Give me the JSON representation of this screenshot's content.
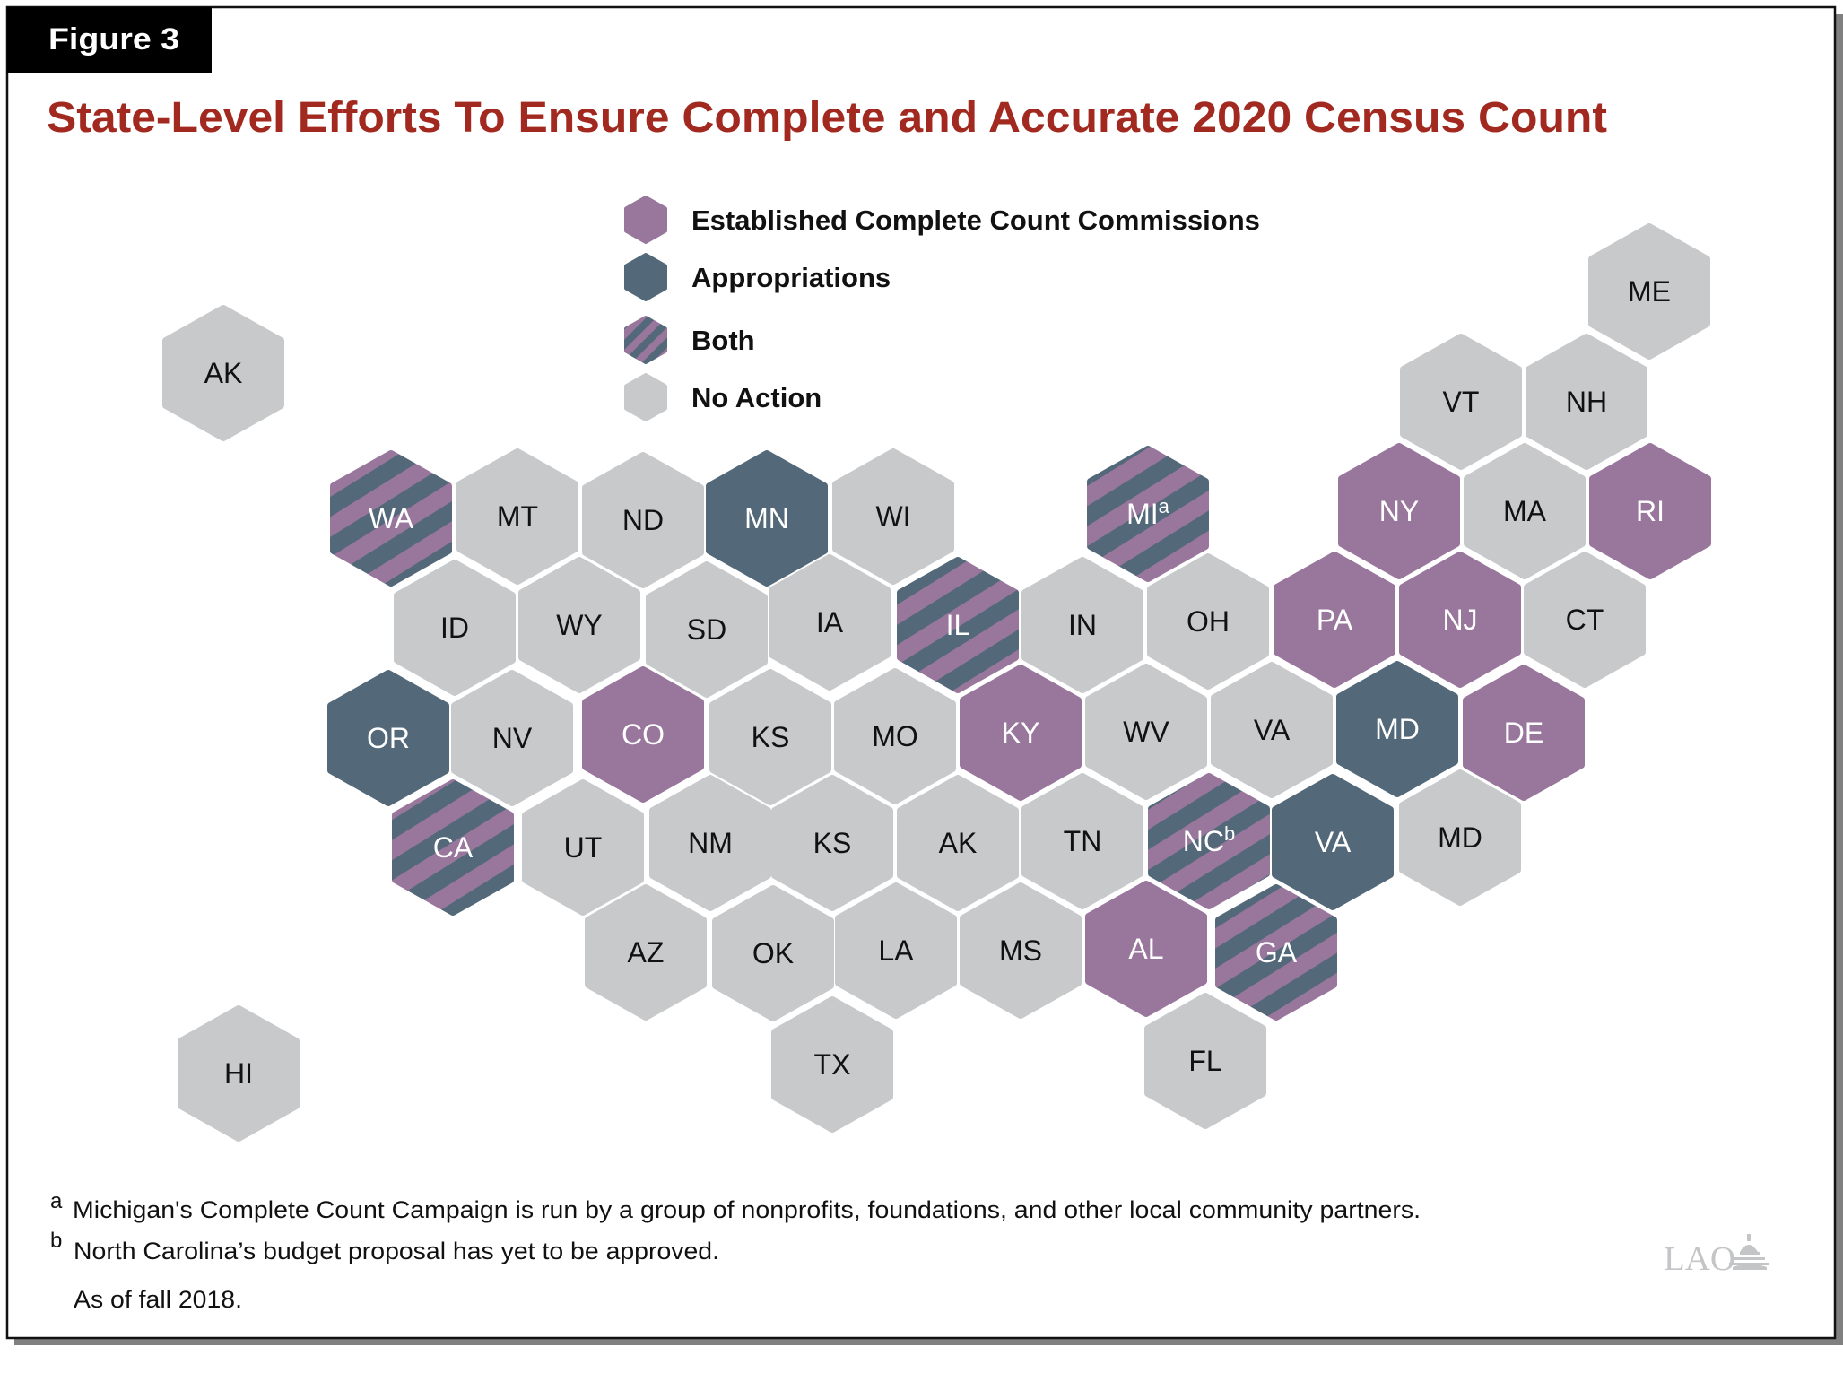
{
  "figure_label": "Figure 3",
  "title": "State-Level Efforts To Ensure Complete and Accurate 2020 Census Count",
  "colors": {
    "commission": "#99769c",
    "appropriations": "#536979",
    "no_action": "#c8c9cb",
    "title": "#a2291f",
    "label_dark": "#111111",
    "label_light": "#ffffff"
  },
  "legend": [
    {
      "key": "commission",
      "label": "Established Complete Count Commissions"
    },
    {
      "key": "appropriations",
      "label": "Appropriations"
    },
    {
      "key": "both",
      "label": "Both"
    },
    {
      "key": "none",
      "label": "No Action"
    }
  ],
  "chart_data": {
    "type": "hexbin-map",
    "title": "State-Level Efforts To Ensure Complete and Accurate 2020 Census Count",
    "legend_placement": "top-center",
    "categories": [
      "commission",
      "appropriations",
      "both",
      "none"
    ],
    "states": [
      {
        "label": "AK",
        "sup": "",
        "status": "none",
        "row": "alaska"
      },
      {
        "label": "ME",
        "sup": "",
        "status": "none",
        "row": "top"
      },
      {
        "label": "VT",
        "sup": "",
        "status": "none",
        "row": "0"
      },
      {
        "label": "NH",
        "sup": "",
        "status": "none",
        "row": "0"
      },
      {
        "label": "WA",
        "sup": "",
        "status": "both",
        "row": "1"
      },
      {
        "label": "MT",
        "sup": "",
        "status": "none",
        "row": "1"
      },
      {
        "label": "ND",
        "sup": "",
        "status": "none",
        "row": "1"
      },
      {
        "label": "MN",
        "sup": "",
        "status": "appropriations",
        "row": "1"
      },
      {
        "label": "WI",
        "sup": "",
        "status": "none",
        "row": "1"
      },
      {
        "label": "MI",
        "sup": "a",
        "status": "both",
        "row": "1"
      },
      {
        "label": "NY",
        "sup": "",
        "status": "commission",
        "row": "1"
      },
      {
        "label": "MA",
        "sup": "",
        "status": "none",
        "row": "1"
      },
      {
        "label": "RI",
        "sup": "",
        "status": "commission",
        "row": "1"
      },
      {
        "label": "ID",
        "sup": "",
        "status": "none",
        "row": "2"
      },
      {
        "label": "WY",
        "sup": "",
        "status": "none",
        "row": "2"
      },
      {
        "label": "SD",
        "sup": "",
        "status": "none",
        "row": "2"
      },
      {
        "label": "IA",
        "sup": "",
        "status": "none",
        "row": "2"
      },
      {
        "label": "IL",
        "sup": "",
        "status": "both",
        "row": "2"
      },
      {
        "label": "IN",
        "sup": "",
        "status": "none",
        "row": "2"
      },
      {
        "label": "OH",
        "sup": "",
        "status": "none",
        "row": "2"
      },
      {
        "label": "PA",
        "sup": "",
        "status": "commission",
        "row": "2"
      },
      {
        "label": "NJ",
        "sup": "",
        "status": "commission",
        "row": "2"
      },
      {
        "label": "CT",
        "sup": "",
        "status": "none",
        "row": "2"
      },
      {
        "label": "OR",
        "sup": "",
        "status": "appropriations",
        "row": "3"
      },
      {
        "label": "NV",
        "sup": "",
        "status": "none",
        "row": "3"
      },
      {
        "label": "CO",
        "sup": "",
        "status": "commission",
        "row": "3"
      },
      {
        "label": "KS",
        "sup": "",
        "status": "none",
        "row": "3"
      },
      {
        "label": "MO",
        "sup": "",
        "status": "none",
        "row": "3"
      },
      {
        "label": "KY",
        "sup": "",
        "status": "commission",
        "row": "3"
      },
      {
        "label": "WV",
        "sup": "",
        "status": "none",
        "row": "3"
      },
      {
        "label": "VA",
        "sup": "",
        "status": "none",
        "row": "3"
      },
      {
        "label": "MD",
        "sup": "",
        "status": "appropriations",
        "row": "3"
      },
      {
        "label": "DE",
        "sup": "",
        "status": "commission",
        "row": "3"
      },
      {
        "label": "CA",
        "sup": "",
        "status": "both",
        "row": "4"
      },
      {
        "label": "UT",
        "sup": "",
        "status": "none",
        "row": "4"
      },
      {
        "label": "NM",
        "sup": "",
        "status": "none",
        "row": "4"
      },
      {
        "label": "KS",
        "sup": "",
        "status": "none",
        "row": "4"
      },
      {
        "label": "AK",
        "sup": "",
        "status": "none",
        "row": "4"
      },
      {
        "label": "TN",
        "sup": "",
        "status": "none",
        "row": "4"
      },
      {
        "label": "NC",
        "sup": "b",
        "status": "both",
        "row": "4"
      },
      {
        "label": "VA",
        "sup": "",
        "status": "appropriations",
        "row": "4"
      },
      {
        "label": "MD",
        "sup": "",
        "status": "none",
        "row": "4"
      },
      {
        "label": "AZ",
        "sup": "",
        "status": "none",
        "row": "5"
      },
      {
        "label": "OK",
        "sup": "",
        "status": "none",
        "row": "5"
      },
      {
        "label": "LA",
        "sup": "",
        "status": "none",
        "row": "5"
      },
      {
        "label": "MS",
        "sup": "",
        "status": "none",
        "row": "5"
      },
      {
        "label": "AL",
        "sup": "",
        "status": "commission",
        "row": "5"
      },
      {
        "label": "GA",
        "sup": "",
        "status": "both",
        "row": "5"
      },
      {
        "label": "TX",
        "sup": "",
        "status": "none",
        "row": "6"
      },
      {
        "label": "FL",
        "sup": "",
        "status": "none",
        "row": "6"
      },
      {
        "label": "HI",
        "sup": "",
        "status": "none",
        "row": "hawaii"
      }
    ]
  },
  "footnotes": [
    {
      "marker": "a",
      "text": "Michigan's Complete Count Campaign is run by a group of nonprofits, foundations, and other local community partners."
    },
    {
      "marker": "b",
      "text": "North Carolina’s budget proposal has yet to be approved."
    }
  ],
  "note": "As of fall 2018.",
  "logo": "LAO"
}
